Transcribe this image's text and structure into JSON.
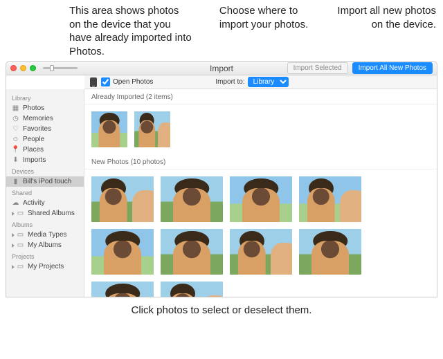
{
  "annotations": {
    "already_imported_area": "This area shows photos on the device that you have already imported into Photos.",
    "import_to": "Choose where to import your photos.",
    "import_all": "Import all new photos on the device.",
    "select_photos": "Click photos to select or deselect them."
  },
  "titlebar": {
    "title": "Import",
    "import_selected": "Import Selected",
    "import_all_new": "Import All New Photos"
  },
  "subbar": {
    "open_photos_label": "Open Photos",
    "import_to_label": "Import to:",
    "import_to_value": "Library"
  },
  "sidebar": {
    "groups": [
      {
        "header": "Library",
        "items": [
          {
            "label": "Photos",
            "icon": "photos"
          },
          {
            "label": "Memories",
            "icon": "clock"
          },
          {
            "label": "Favorites",
            "icon": "heart"
          },
          {
            "label": "People",
            "icon": "person"
          },
          {
            "label": "Places",
            "icon": "pin"
          },
          {
            "label": "Imports",
            "icon": "download"
          }
        ]
      },
      {
        "header": "Devices",
        "items": [
          {
            "label": "Bill's iPod touch",
            "icon": "ipod",
            "selected": true
          }
        ]
      },
      {
        "header": "Shared",
        "items": [
          {
            "label": "Activity",
            "icon": "cloud"
          },
          {
            "label": "Shared Albums",
            "icon": "album",
            "tri": true
          }
        ]
      },
      {
        "header": "Albums",
        "items": [
          {
            "label": "Media Types",
            "icon": "album",
            "tri": true
          },
          {
            "label": "My Albums",
            "icon": "album",
            "tri": true
          }
        ]
      },
      {
        "header": "Projects",
        "items": [
          {
            "label": "My Projects",
            "icon": "album",
            "tri": true
          }
        ]
      }
    ]
  },
  "sections": {
    "already": {
      "title": "Already Imported (2 items)",
      "count": 2
    },
    "new": {
      "title": "New Photos (10 photos)",
      "count": 10
    }
  }
}
